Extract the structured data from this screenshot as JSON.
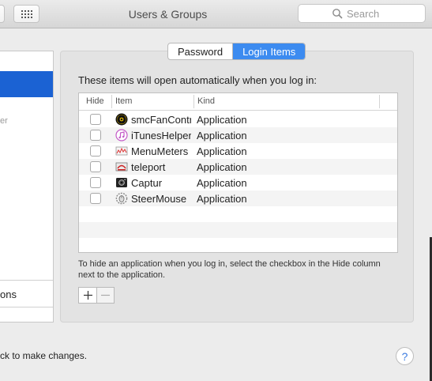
{
  "window": {
    "title": "Users & Groups"
  },
  "search": {
    "placeholder": "Search"
  },
  "left_panel": {
    "truncated_sub_text": "er",
    "truncated_bottom_label": "ons"
  },
  "tabs": [
    {
      "label": "Password",
      "active": false
    },
    {
      "label": "Login Items",
      "active": true
    }
  ],
  "intro_text": "These items will open automatically when you log in:",
  "table": {
    "headers": {
      "hide": "Hide",
      "item": "Item",
      "kind": "Kind"
    },
    "rows": [
      {
        "name": "smcFanContr",
        "kind": "Application",
        "hide": false,
        "icon": "radiation-icon"
      },
      {
        "name": "iTunesHelper",
        "kind": "Application",
        "hide": false,
        "icon": "itunes-icon"
      },
      {
        "name": "MenuMeters",
        "kind": "Application",
        "hide": false,
        "icon": "meter-icon"
      },
      {
        "name": "teleport",
        "kind": "Application",
        "hide": false,
        "icon": "teleport-icon"
      },
      {
        "name": "Captur",
        "kind": "Application",
        "hide": false,
        "icon": "camera-icon"
      },
      {
        "name": "SteerMouse",
        "kind": "Application",
        "hide": false,
        "icon": "mouse-icon"
      }
    ]
  },
  "hint_text": "To hide an application when you log in, select the checkbox in the Hide column next to the application.",
  "buttons": {
    "add": "+",
    "remove": "−"
  },
  "lock_text": "ck to make changes.",
  "help_label": "?",
  "colors": {
    "accent": "#3c8bf0",
    "selection": "#1b62d3"
  }
}
